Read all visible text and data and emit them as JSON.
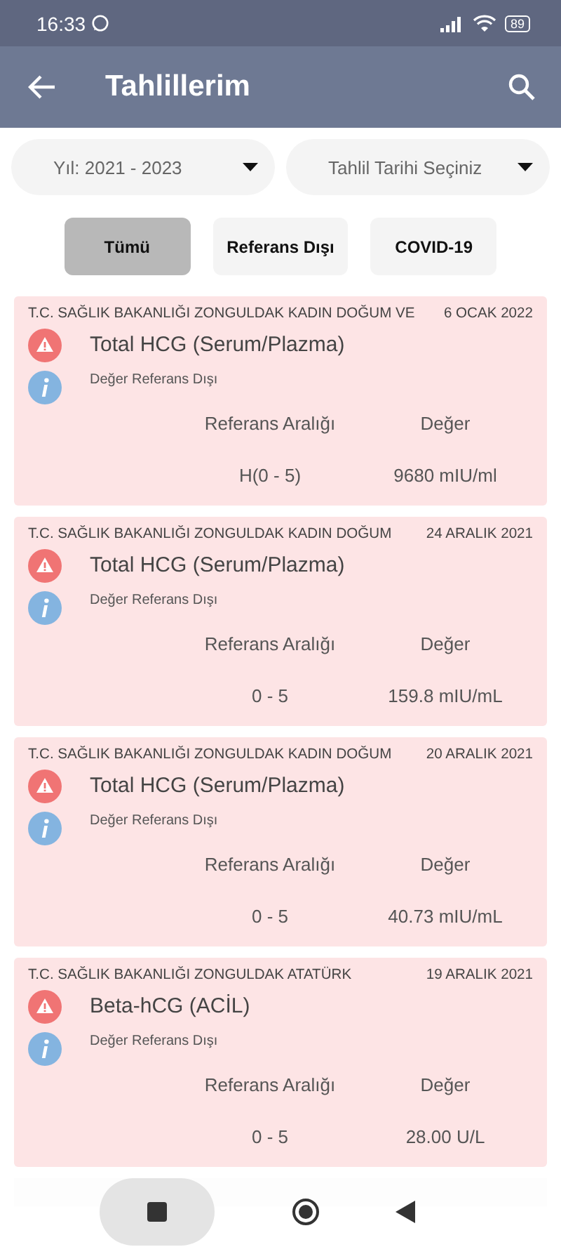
{
  "status_bar": {
    "time": "16:33",
    "battery": "89"
  },
  "header": {
    "title": "Tahlillerim"
  },
  "filters": [
    {
      "label": "Yıl: 2021 - 2023"
    },
    {
      "label": "Tahlil Tarihi Seçiniz"
    }
  ],
  "chips": [
    {
      "label": "Tümü",
      "selected": true
    },
    {
      "label": "Referans Dışı",
      "selected": false
    },
    {
      "label": "COVID-19",
      "selected": false
    }
  ],
  "results": [
    {
      "hospital": "T.C. SAĞLIK BAKANLIĞI ZONGULDAK KADIN DOĞUM VE",
      "date": "6 OCAK 2022",
      "test": "Total HCG (Serum/Plazma)",
      "status": "Değer Referans Dışı",
      "range_label": "Referans Aralığı",
      "value_label": "Değer",
      "range": "H(0 - 5)",
      "value": "9680 mIU/ml",
      "out_of_range": true
    },
    {
      "hospital": "T.C. SAĞLIK BAKANLIĞI ZONGULDAK KADIN DOĞUM",
      "date": "24 ARALIK 2021",
      "test": "Total HCG (Serum/Plazma)",
      "status": "Değer Referans Dışı",
      "range_label": "Referans Aralığı",
      "value_label": "Değer",
      "range": "0 - 5",
      "value": "159.8 mIU/mL",
      "out_of_range": true
    },
    {
      "hospital": "T.C. SAĞLIK BAKANLIĞI ZONGULDAK KADIN DOĞUM",
      "date": "20 ARALIK 2021",
      "test": "Total HCG (Serum/Plazma)",
      "status": "Değer Referans Dışı",
      "range_label": "Referans Aralığı",
      "value_label": "Değer",
      "range": "0 - 5",
      "value": "40.73 mIU/mL",
      "out_of_range": true
    },
    {
      "hospital": "T.C. SAĞLIK BAKANLIĞI ZONGULDAK ATATÜRK",
      "date": "19 ARALIK 2021",
      "test": "Beta-hCG (ACİL)",
      "status": "Değer Referans Dışı",
      "range_label": "Referans Aralığı",
      "value_label": "Değer",
      "range": "0 - 5",
      "value": "28.00 U/L",
      "out_of_range": true
    }
  ]
}
